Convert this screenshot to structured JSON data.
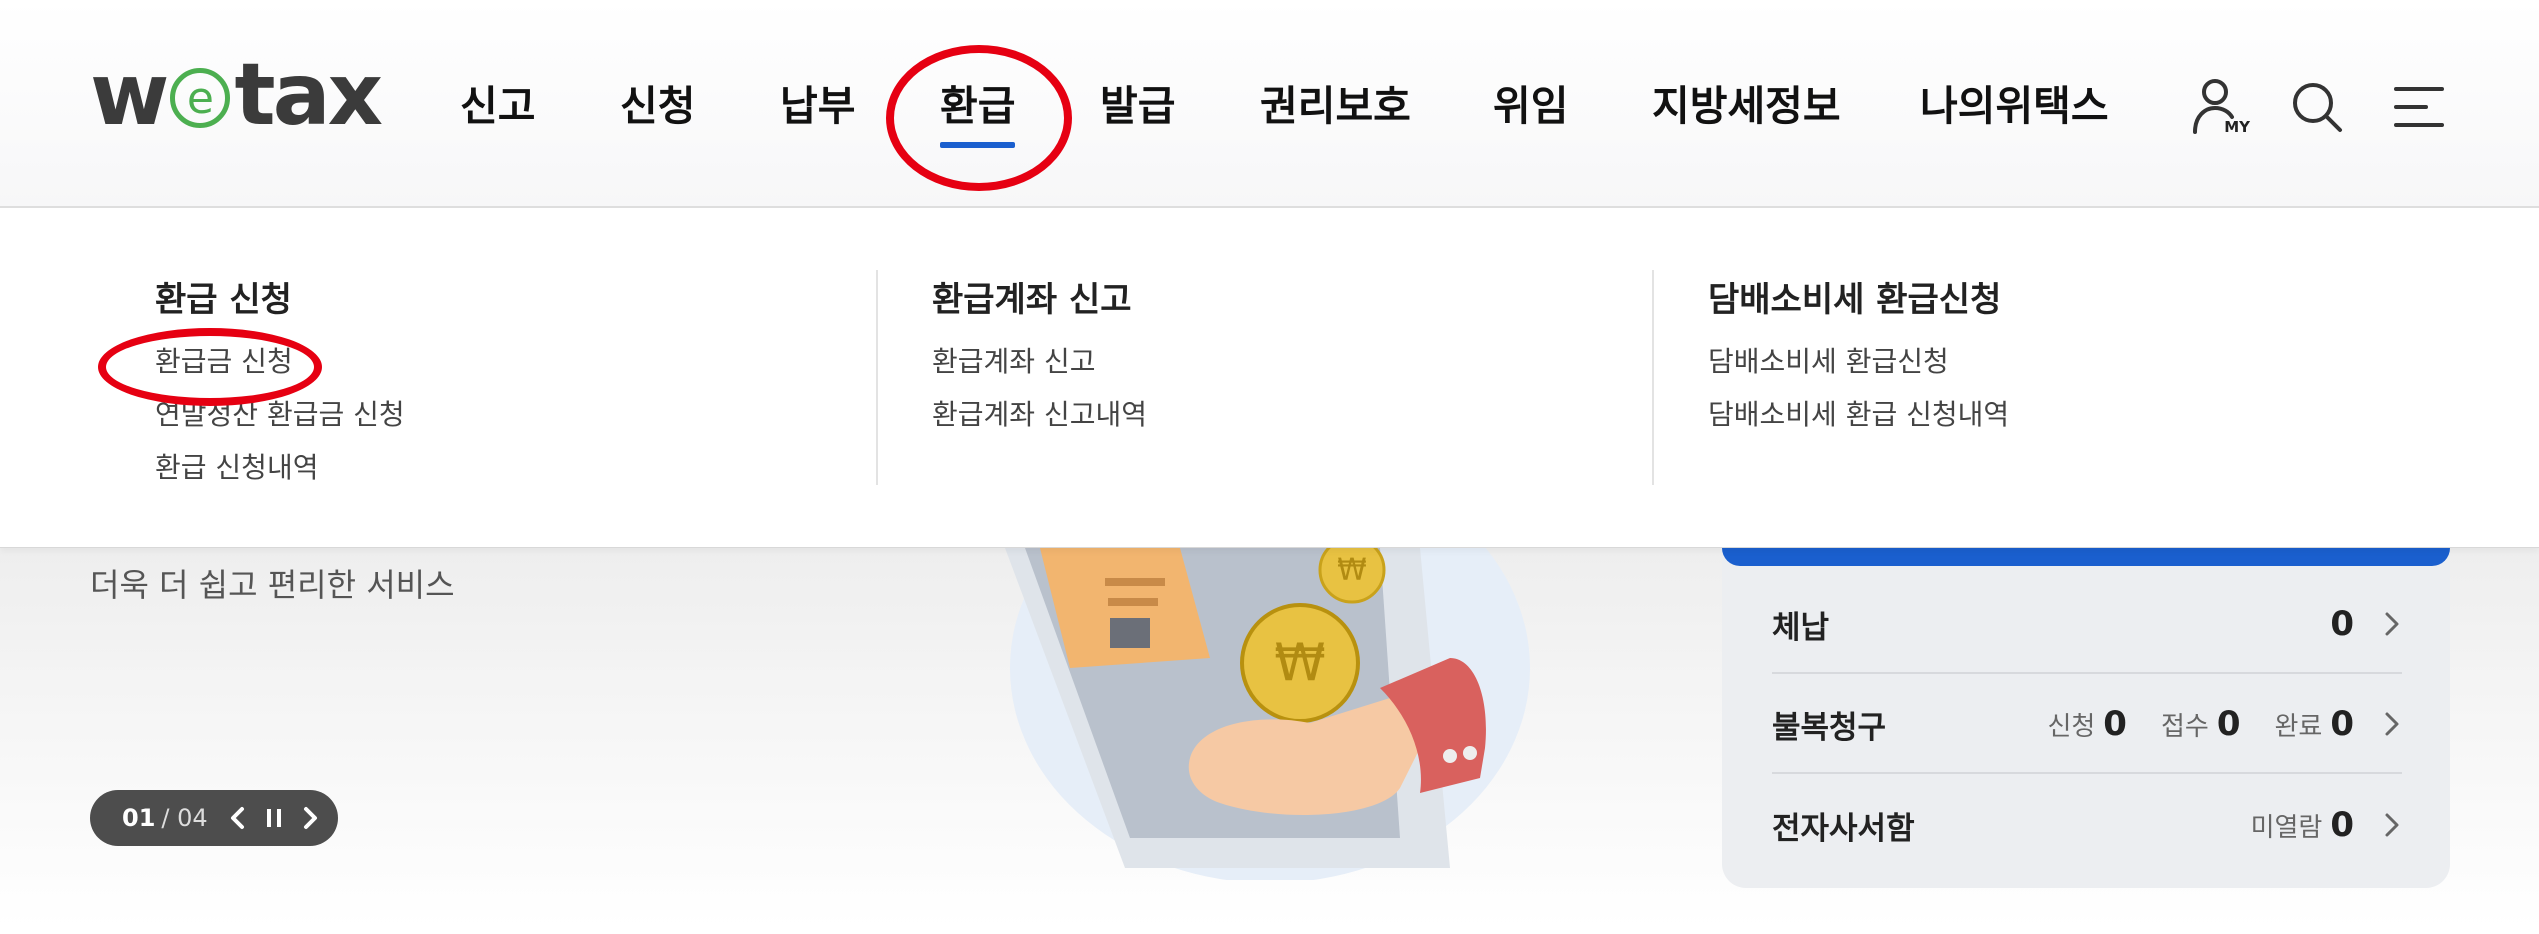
{
  "header": {
    "logo": {
      "before": "w",
      "circled": "e",
      "after": "tax"
    },
    "nav": [
      {
        "label": "신고"
      },
      {
        "label": "신청"
      },
      {
        "label": "납부"
      },
      {
        "label": "환급",
        "active": true
      },
      {
        "label": "발급"
      },
      {
        "label": "권리보호"
      },
      {
        "label": "위임"
      },
      {
        "label": "지방세정보"
      },
      {
        "label": "나의위택스"
      }
    ],
    "icons": {
      "my": "MY",
      "search": "search-icon",
      "menu": "menu-icon"
    }
  },
  "dropdown": {
    "columns": [
      {
        "title": "환급 신청",
        "links": [
          "환급금 신청",
          "연말정산 환급금 신청",
          "환급 신청내역"
        ]
      },
      {
        "title": "환급계좌 신고",
        "links": [
          "환급계좌 신고",
          "환급계좌 신고내역"
        ]
      },
      {
        "title": "담배소비세 환급신청",
        "links": [
          "담배소비세 환급신청",
          "담배소비세 환급 신청내역"
        ]
      }
    ]
  },
  "hero": {
    "subtitle": "더욱 더 쉽고 편리한 서비스",
    "slider": {
      "current": "01",
      "total": "/ 04"
    }
  },
  "status": {
    "rows": [
      {
        "label": "체납",
        "value": "0"
      },
      {
        "label": "불복청구",
        "pairs": [
          {
            "k": "신청",
            "v": "0"
          },
          {
            "k": "접수",
            "v": "0"
          },
          {
            "k": "완료",
            "v": "0"
          }
        ]
      },
      {
        "label": "전자사서함",
        "pairs": [
          {
            "k": "미열람",
            "v": "0"
          }
        ]
      }
    ]
  },
  "colors": {
    "accent_blue": "#1a5fce",
    "logo_green": "#4caf50",
    "annotation_red": "#e60012"
  }
}
